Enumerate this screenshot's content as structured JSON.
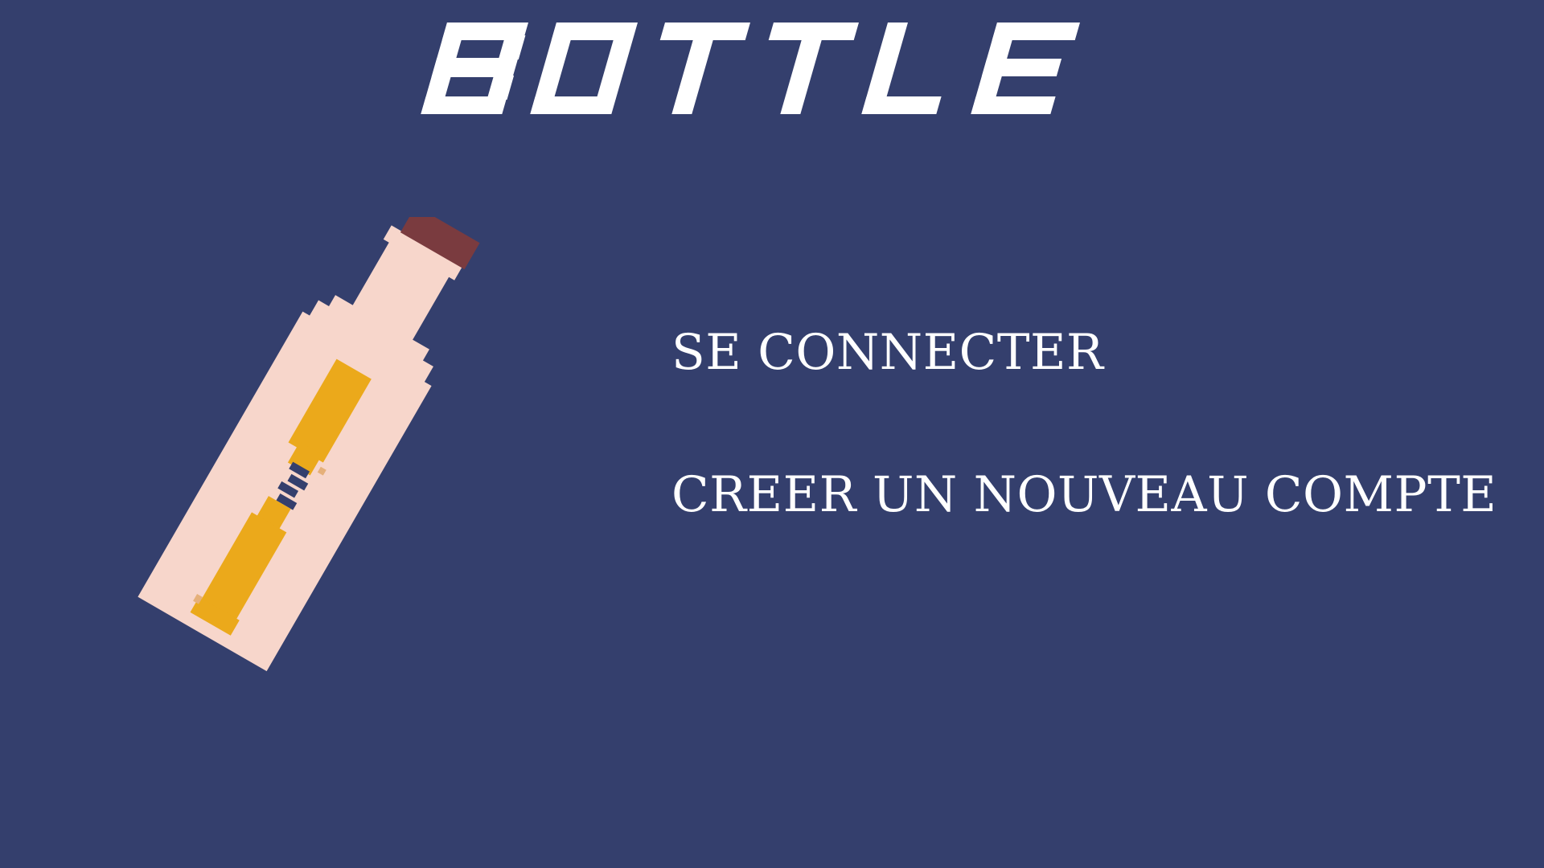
{
  "game": {
    "title": "BOTTLE"
  },
  "menu": {
    "login_label": "SE CONNECTER",
    "register_label": "CREER UN NOUVEAU COMPTE"
  },
  "colors": {
    "background": "#343f6d",
    "text": "#ffffff",
    "bottle_glass": "#f7d6cb",
    "bottle_cork": "#7a3b3f",
    "scroll_paper": "#eba91b",
    "scroll_shadow": "#e5b07a"
  },
  "icons": {
    "bottle": "message-in-a-bottle"
  }
}
